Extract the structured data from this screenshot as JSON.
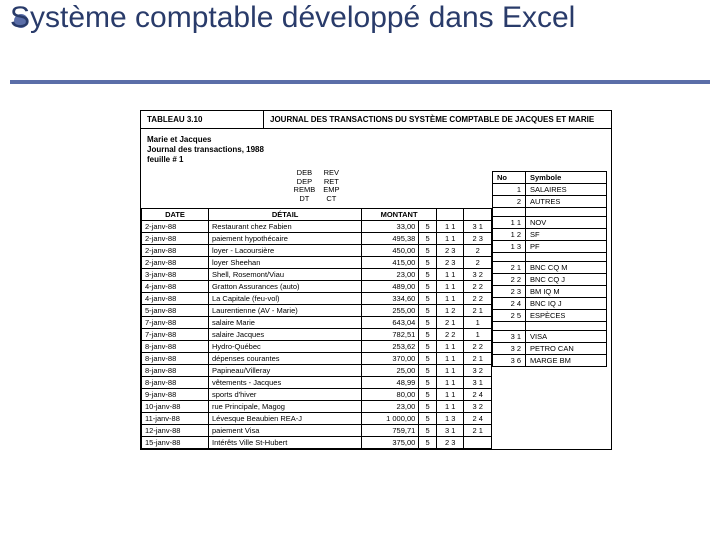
{
  "title": "Système comptable développé dans Excel",
  "caption": {
    "label": "TABLEAU 3.10",
    "text": "JOURNAL DES TRANSACTIONS DU SYSTÈME COMPTABLE DE JACQUES ET MARIE"
  },
  "meta": {
    "l1": "Marie et Jacques",
    "l2": "Journal des transactions, 1988",
    "l3": "feuille # 1"
  },
  "codes": [
    [
      "DEB",
      "REV"
    ],
    [
      "DEP",
      "RET"
    ],
    [
      "REMB",
      "EMP"
    ],
    [
      "DT",
      "CT"
    ]
  ],
  "jhead": {
    "date": "DATE",
    "detail": "DÉTAIL",
    "montant": "MONTANT"
  },
  "rows": [
    {
      "d": "2-janv-88",
      "t": "Restaurant chez Fabien",
      "m": "33,00",
      "s": "5",
      "c1": "1 1",
      "c2": "3 1"
    },
    {
      "d": "2-janv-88",
      "t": "paiement hypothécaire",
      "m": "495,38",
      "s": "5",
      "c1": "1 1",
      "c2": "2 3"
    },
    {
      "d": "2-janv-88",
      "t": "loyer - Lacoursière",
      "m": "450,00",
      "s": "5",
      "c1": "2 3",
      "c2": "2"
    },
    {
      "d": "2-janv-88",
      "t": "loyer Sheehan",
      "m": "415,00",
      "s": "5",
      "c1": "2 3",
      "c2": "2"
    },
    {
      "d": "3-janv-88",
      "t": "Shell, Rosemont/Viau",
      "m": "23,00",
      "s": "5",
      "c1": "1 1",
      "c2": "3 2"
    },
    {
      "d": "4-janv-88",
      "t": "Gratton Assurances (auto)",
      "m": "489,00",
      "s": "5",
      "c1": "1 1",
      "c2": "2 2"
    },
    {
      "d": "4-janv-88",
      "t": "La Capitale (feu-vol)",
      "m": "334,60",
      "s": "5",
      "c1": "1 1",
      "c2": "2 2"
    },
    {
      "d": "5-janv-88",
      "t": "Laurentienne (AV - Marie)",
      "m": "255,00",
      "s": "5",
      "c1": "1 2",
      "c2": "2 1"
    },
    {
      "d": "7-janv-88",
      "t": "salaire Marie",
      "m": "643,04",
      "s": "5",
      "c1": "2 1",
      "c2": "1"
    },
    {
      "d": "7-janv-88",
      "t": "salaire Jacques",
      "m": "782,51",
      "s": "5",
      "c1": "2 2",
      "c2": "1"
    },
    {
      "d": "8-janv-88",
      "t": "Hydro-Québec",
      "m": "253,62",
      "s": "5",
      "c1": "1 1",
      "c2": "2 2"
    },
    {
      "d": "8-janv-88",
      "t": "dépenses courantes",
      "m": "370,00",
      "s": "5",
      "c1": "1 1",
      "c2": "2 1"
    },
    {
      "d": "8-janv-88",
      "t": "Papineau/Villeray",
      "m": "25,00",
      "s": "5",
      "c1": "1 1",
      "c2": "3 2"
    },
    {
      "d": "8-janv-88",
      "t": "vêtements - Jacques",
      "m": "48,99",
      "s": "5",
      "c1": "1 1",
      "c2": "3 1"
    },
    {
      "d": "9-janv-88",
      "t": "sports d'hiver",
      "m": "80,00",
      "s": "5",
      "c1": "1 1",
      "c2": "2 4"
    },
    {
      "d": "10-janv-88",
      "t": "rue Principale, Magog",
      "m": "23,00",
      "s": "5",
      "c1": "1 1",
      "c2": "3 2"
    },
    {
      "d": "11-janv-88",
      "t": "Lévesque Beaubien REA-J",
      "m": "1 000,00",
      "s": "5",
      "c1": "1 3",
      "c2": "2 4"
    },
    {
      "d": "12-janv-88",
      "t": "paiement Visa",
      "m": "759,71",
      "s": "5",
      "c1": "3 1",
      "c2": "2 1"
    },
    {
      "d": "15-janv-88",
      "t": "Intérêts Ville St-Hubert",
      "m": "375,00",
      "s": "5",
      "c1": "2 3",
      "c2": ""
    }
  ],
  "shead": {
    "no": "No",
    "sym": "Symbole"
  },
  "symbols": [
    [
      {
        "n": "1",
        "t": "SALAIRES"
      },
      {
        "n": "2",
        "t": "AUTRES"
      }
    ],
    [
      {
        "n": "1 1",
        "t": "NOV"
      },
      {
        "n": "1 2",
        "t": "SF"
      },
      {
        "n": "1 3",
        "t": "PF"
      }
    ],
    [
      {
        "n": "2 1",
        "t": "BNC CQ M"
      },
      {
        "n": "2 2",
        "t": "BNC CQ J"
      },
      {
        "n": "2 3",
        "t": "BM IQ M"
      },
      {
        "n": "2 4",
        "t": "BNC IQ J"
      },
      {
        "n": "2 5",
        "t": "ESPÈCES"
      }
    ],
    [
      {
        "n": "3 1",
        "t": "VISA"
      },
      {
        "n": "3 2",
        "t": "PETRO CAN"
      },
      {
        "n": "3 6",
        "t": "MARGE BM"
      }
    ]
  ]
}
